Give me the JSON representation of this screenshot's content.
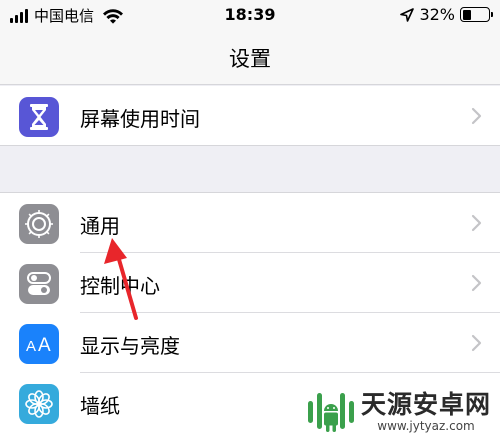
{
  "status_bar": {
    "carrier": "中国电信",
    "time": "18:39",
    "battery_percent": "32%",
    "battery_level": 0.32
  },
  "nav": {
    "title": "设置"
  },
  "groups": [
    {
      "items": [
        {
          "label": "屏幕使用时间",
          "icon": "hourglass-icon",
          "color": "#5856d6"
        }
      ]
    },
    {
      "items": [
        {
          "label": "通用",
          "icon": "gear-icon",
          "color": "#8e8e93"
        },
        {
          "label": "控制中心",
          "icon": "toggle-switches-icon",
          "color": "#8e8e93"
        },
        {
          "label": "显示与亮度",
          "icon": "text-size-icon",
          "color": "#1a82fb"
        },
        {
          "label": "墙纸",
          "icon": "flower-icon",
          "color": "#35aadc"
        }
      ]
    }
  ],
  "annotation": {
    "arrow_color": "#e8262b",
    "points_to": "通用"
  },
  "watermark": {
    "name": "天源安卓网",
    "url": "www.jytyaz.com",
    "logo_color": "#3ba04c"
  }
}
